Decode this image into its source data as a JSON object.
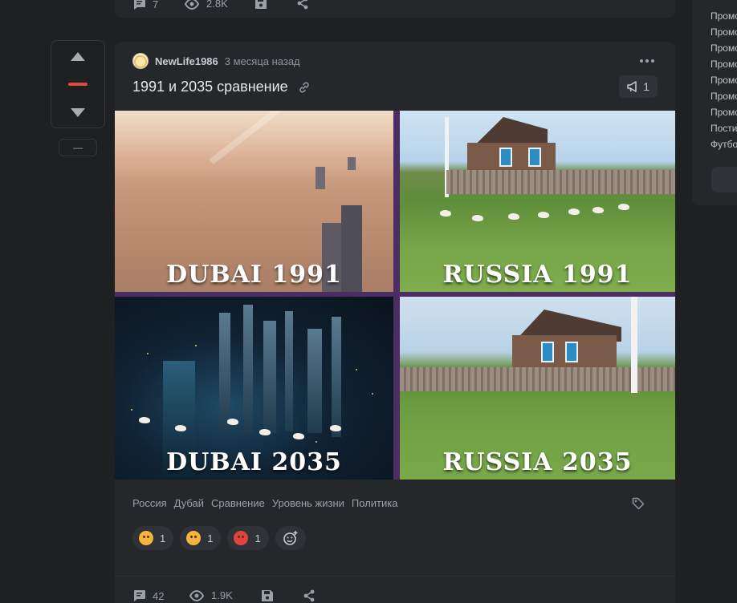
{
  "prev_post": {
    "comments": "7",
    "views": "2.8K"
  },
  "vote": {
    "more_label": "—"
  },
  "post": {
    "author": "NewLife1986",
    "time": "3 месяца назад",
    "title": "1991 и 2035 сравнение",
    "comment_badge": "1",
    "images": {
      "dubai_1991": "DUBAI 1991",
      "russia_1991": "RUSSIA 1991",
      "dubai_2035": "DUBAI 2035",
      "russia_2035": "RUSSIA 2035"
    },
    "tags": [
      "Россия",
      "Дубай",
      "Сравнение",
      "Уровень жизни",
      "Политика"
    ],
    "reactions": [
      {
        "icon": "star-struck-emoji-icon",
        "count": "1"
      },
      {
        "icon": "star-struck-emoji-icon",
        "count": "1"
      },
      {
        "icon": "angry-emoji-icon",
        "count": "1"
      }
    ],
    "footer": {
      "comments": "42",
      "views": "1.9K"
    }
  },
  "sidebar": {
    "items": [
      "Промо",
      "Промо",
      "Промо",
      "Промо",
      "Промо",
      "Промо",
      "Промо",
      "Пости",
      "Футбо"
    ]
  },
  "colors": {
    "background": "#1e2022",
    "card": "#25282b",
    "vote_score": "#e04a3c",
    "image_border": "#4b2c63"
  }
}
